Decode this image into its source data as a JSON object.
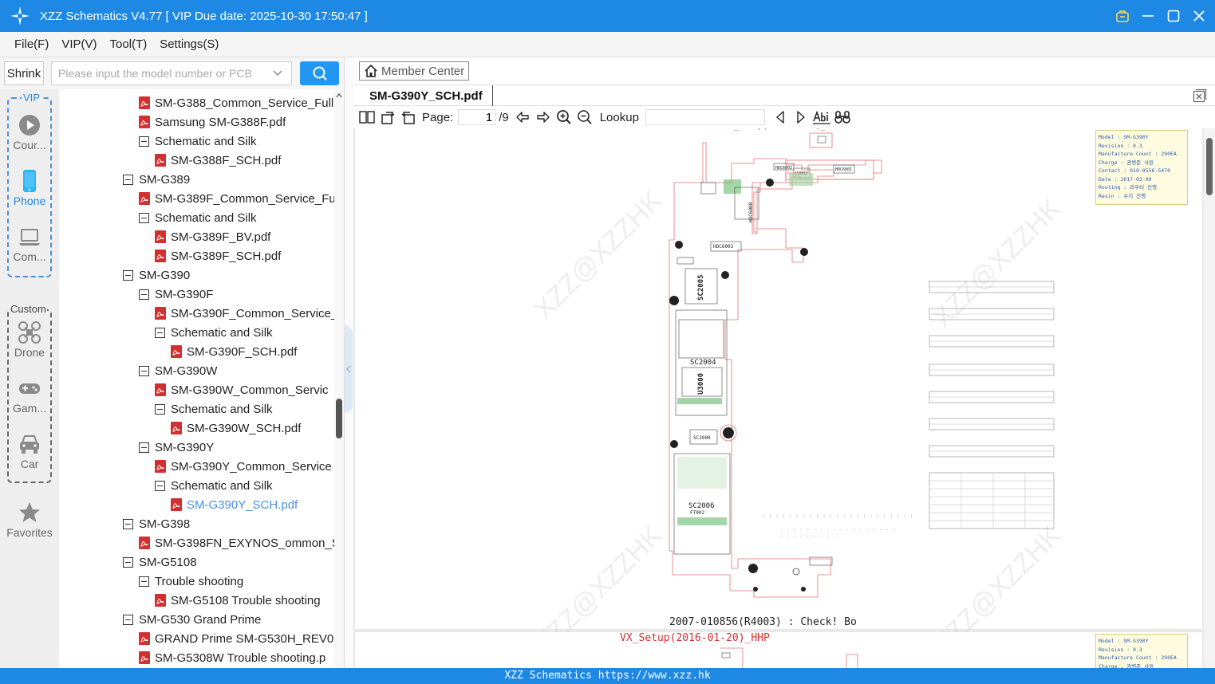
{
  "app": {
    "title": "XZZ Schematics V4.77 [ VIP Due date: 2025-10-30 17:50:47 ]"
  },
  "menu": [
    "File(F)",
    "VIP(V)",
    "Tool(T)",
    "Settings(S)"
  ],
  "toolbar": {
    "shrink_label": "Shrink",
    "search_placeholder": "Please input the model number or PCB"
  },
  "categories": {
    "vip_label": "VIP",
    "custom_label": "Custom",
    "vip_items": [
      {
        "label": "Cour...",
        "icon": "play-circle-icon"
      },
      {
        "label": "Phone",
        "icon": "phone-icon",
        "active": true
      },
      {
        "label": "Com...",
        "icon": "laptop-icon"
      }
    ],
    "custom_items": [
      {
        "label": "Drone",
        "icon": "drone-icon"
      },
      {
        "label": "Gam...",
        "icon": "gamepad-icon"
      },
      {
        "label": "Car",
        "icon": "car-icon"
      }
    ],
    "favorites_label": "Favorites"
  },
  "tree": [
    {
      "label": "SM-G388_Common_Service_Full",
      "type": "pdf",
      "level": 1
    },
    {
      "label": "Samsung SM-G388F.pdf",
      "type": "pdf",
      "level": 1
    },
    {
      "label": "Schematic and Silk",
      "type": "folder",
      "level": 1
    },
    {
      "label": "SM-G388F_SCH.pdf",
      "type": "pdf",
      "level": 2
    },
    {
      "label": "SM-G389",
      "type": "folder",
      "level": 0
    },
    {
      "label": "SM-G389F_Common_Service_Fu",
      "type": "pdf",
      "level": 1
    },
    {
      "label": "Schematic and Silk",
      "type": "folder",
      "level": 1
    },
    {
      "label": "SM-G389F_BV.pdf",
      "type": "pdf",
      "level": 2
    },
    {
      "label": "SM-G389F_SCH.pdf",
      "type": "pdf",
      "level": 2
    },
    {
      "label": "SM-G390",
      "type": "folder",
      "level": 0
    },
    {
      "label": "SM-G390F",
      "type": "folder",
      "level": 1
    },
    {
      "label": "SM-G390F_Common_Service_",
      "type": "pdf",
      "level": 2
    },
    {
      "label": "Schematic and Silk",
      "type": "folder",
      "level": 2
    },
    {
      "label": "SM-G390F_SCH.pdf",
      "type": "pdf",
      "level": 3
    },
    {
      "label": "SM-G390W",
      "type": "folder",
      "level": 1
    },
    {
      "label": "SM-G390W_Common_Servic",
      "type": "pdf",
      "level": 2
    },
    {
      "label": "Schematic and Silk",
      "type": "folder",
      "level": 2
    },
    {
      "label": "SM-G390W_SCH.pdf",
      "type": "pdf",
      "level": 3
    },
    {
      "label": "SM-G390Y",
      "type": "folder",
      "level": 1
    },
    {
      "label": "SM-G390Y_Common_Service",
      "type": "pdf",
      "level": 2
    },
    {
      "label": "Schematic and Silk",
      "type": "folder",
      "level": 2
    },
    {
      "label": "SM-G390Y_SCH.pdf",
      "type": "pdf",
      "level": 3,
      "selected": true
    },
    {
      "label": "SM-G398",
      "type": "folder",
      "level": 0
    },
    {
      "label": "SM-G398FN_EXYNOS_ommon_S",
      "type": "pdf",
      "level": 1
    },
    {
      "label": "SM-G5108",
      "type": "folder",
      "level": 0
    },
    {
      "label": "Trouble shooting",
      "type": "folder",
      "level": 1
    },
    {
      "label": "SM-G5108 Trouble shooting",
      "type": "pdf",
      "level": 2
    },
    {
      "label": "SM-G530 Grand Prime",
      "type": "folder",
      "level": 0
    },
    {
      "label": "GRAND Prime SM-G530H_REV0",
      "type": "pdf",
      "level": 1
    },
    {
      "label": "SM-G5308W Trouble shooting.p",
      "type": "pdf",
      "level": 1
    }
  ],
  "viewer": {
    "member_center": "Member Center",
    "active_tab": "SM-G390Y_SCH.pdf",
    "page_label": "Page:",
    "page_current": "1",
    "page_total": "/9",
    "lookup_label": "Lookup",
    "page1_footer": "2007-010856(R4003) : Check! Bo",
    "page2_header": "VX_Setup(2016-01-20)_HHP",
    "watermark": "XZZ@XZZHK",
    "info_box": {
      "lines": [
        "Model : SM-G390Y",
        "Revision : 0.3",
        "Manufacture Count : 290EA",
        "Charge : 권병준 사원",
        "Contact : 010-8556-5470",
        "Date : 2017-02-09",
        "Routing : 라우터 진행",
        "Resin : 수지 진행"
      ]
    },
    "pcb_labels": [
      "U2002",
      "HDC6000",
      "HDC6003",
      "SC2005",
      "SC2004",
      "U3000",
      "SC2000",
      "SC2006",
      "FT002"
    ]
  },
  "status": {
    "text": "XZZ Schematics https://www.xzz.hk"
  },
  "colors": {
    "accent": "#1e88e5",
    "selected_text": "#4a90e2",
    "pdf_icon": "#d32f2f",
    "board_outline": "#e57373"
  }
}
